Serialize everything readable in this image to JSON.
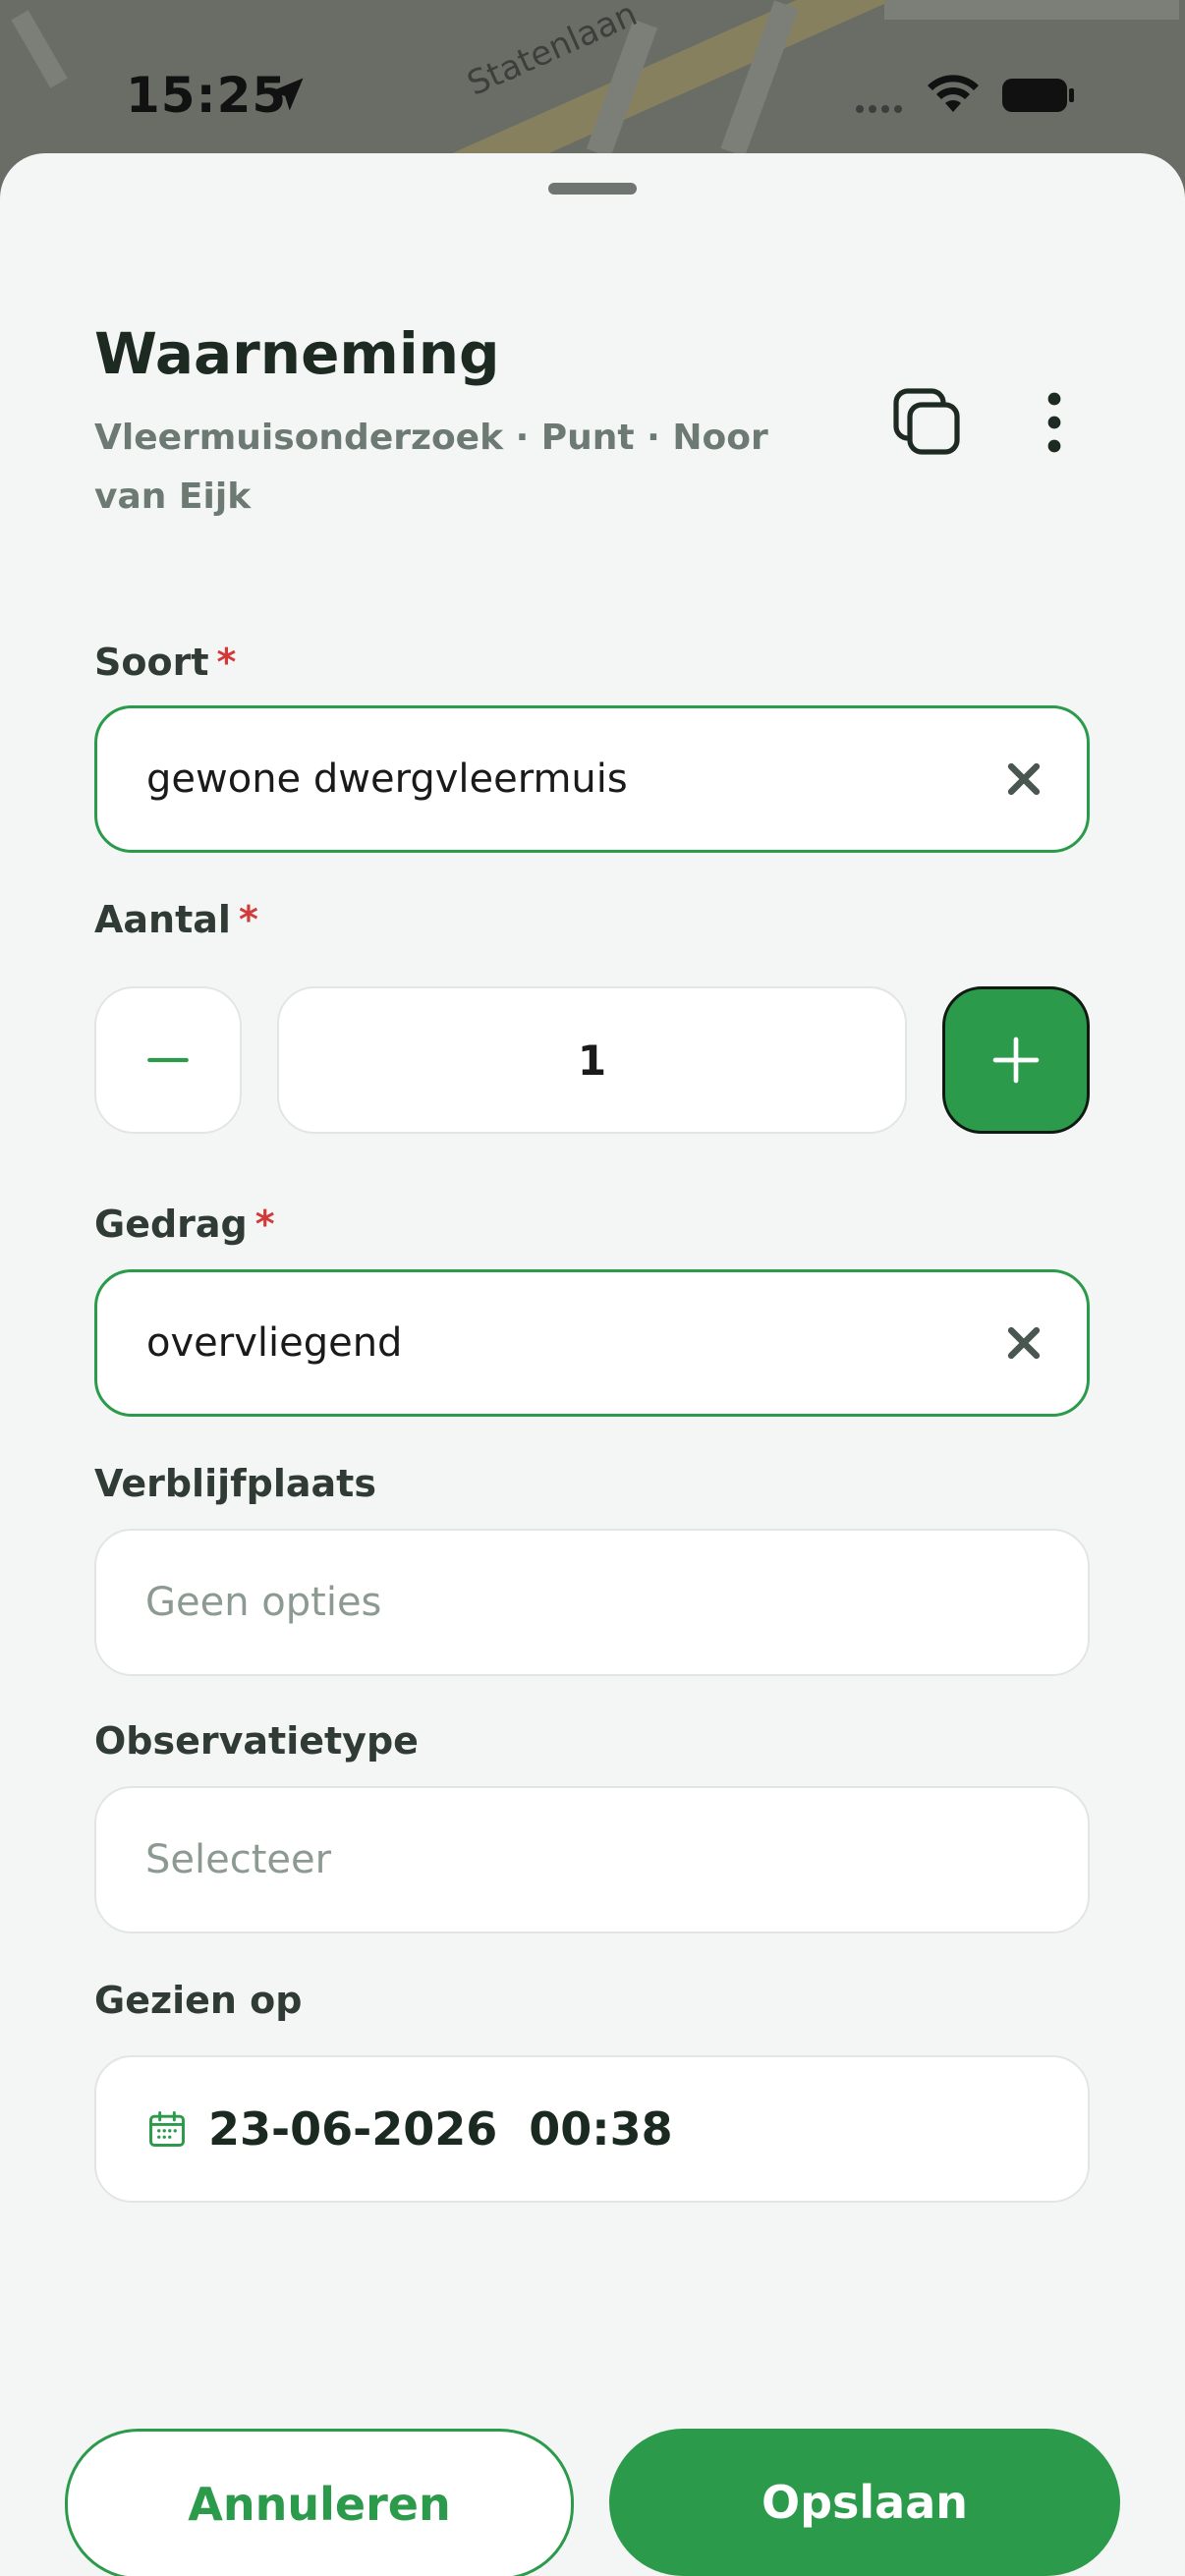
{
  "status_bar": {
    "time": "15:25",
    "map_street": "Statenlaan"
  },
  "header": {
    "title": "Waarneming",
    "subtitle": "Vleermuisonderzoek · Punt · Noor van Eijk",
    "icons": [
      "copy-icon",
      "more-vertical-icon"
    ]
  },
  "form": {
    "soort": {
      "label": "Soort",
      "required_mark": "*",
      "value": "gewone dwergvleermuis"
    },
    "aantal": {
      "label": "Aantal",
      "required_mark": "*",
      "value": "1"
    },
    "gedrag": {
      "label": "Gedrag",
      "required_mark": "*",
      "value": "overvliegend"
    },
    "verblijfplaats": {
      "label": "Verblijfplaats",
      "placeholder": "Geen opties"
    },
    "observatietype": {
      "label": "Observatietype",
      "placeholder": "Selecteer"
    },
    "gezien_op": {
      "label": "Gezien op",
      "value": "23-06-2026  00:38"
    }
  },
  "actions": {
    "cancel_label": "Annuleren",
    "save_label": "Opslaan"
  },
  "colors": {
    "accent": "#2b9a4b",
    "required": "#d23a3a",
    "sheet_bg": "#f4f6f5"
  }
}
